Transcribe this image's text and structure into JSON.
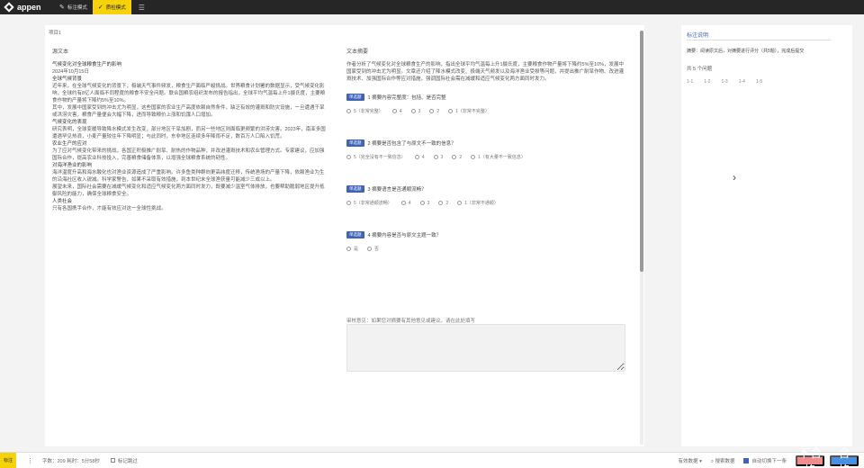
{
  "app": {
    "logo_text": "appen"
  },
  "topbar": {
    "tabs": [
      {
        "label": "标注模式",
        "icon": "edit-icon"
      },
      {
        "label": "质检模式",
        "icon": "check-icon"
      }
    ],
    "extra_icon": "list-icon"
  },
  "card": {
    "header": "项目1",
    "left_title": "源文本",
    "right_title": "文本摘要"
  },
  "source_text": [
    "气候变化对全球粮食生产的影响",
    "2024年10月15日",
    "全球气候背景",
    "近年来，在全球气候变化的背景下，极端天气事件频发，粮食生产面临严峻挑战。世界粮食计划署的数据显示，受气候变化影响，全球约有8亿人面临不同程度的粮食不安全问题。联合国粮农组织发布的报告指出，全球平均气温每上升1摄氏度，主要粮食作物的产量将下降约5%至10%。",
    "其中，发展中国家受到的冲击尤为明显，这些国家的农业生产高度依赖自然条件，缺乏有效的灌溉和防灾设施，一旦遭遇干旱或洪涝灾害，粮食产量便会大幅下降，进而导致粮价上涨和饥饿人口增加。",
    "气候变化的表现",
    "研究表明，全球变暖导致降水模式发生改变，部分地区干旱加剧，而另一些地区则面临更频繁的洪涝灾害。2023年，南亚多国遭遇罕见热浪，小麦产量较往年下降明显；与此同时，东非地区连续多年降雨不足，数百万人口陷入饥荒。",
    "农业生产的应对",
    "为了应对气候变化带来的挑战，各国正积极推广耐旱、耐热的作物品种，并改进灌溉技术和农业管理方式。专家建议，应加强国际合作，提高农业科技投入，完善粮食储备体系，以增强全球粮食系统的韧性。",
    "对海洋渔业的影响",
    "海洋温度升高和海水酸化也对渔业资源造成了严重影响。许多鱼类种群向更高纬度迁移，传统渔场的产量下降，依赖渔业为生的沿海社区收入锐减。科学家警告，如果不采取有效措施，到本世纪末全球渔获量可能减少三成以上。",
    "展望未来，国际社会需要在减缓气候变化和适应气候变化两方面同时发力，既要减少温室气体排放，也要帮助脆弱地区提升抵御风险的能力，确保全球粮食安全。",
    "人类社会",
    "只有各国携手合作，才能有效应对这一全球性挑战。"
  ],
  "summary": {
    "text": "作者分析了气候变化对全球粮食生产的影响，指出全球平均气温每上升1摄氏度，主要粮食作物产量将下降约5%至10%，发展中国家受到的冲击尤为明显。文章还介绍了降水模式改变、极端天气频发以及海洋渔业受损等问题，并提出推广耐旱作物、改进灌溉技术、加强国际合作等应对措施，强调国际社会需在减缓和适应气候变化两方面同时发力。"
  },
  "questions": [
    {
      "badge": "单选题",
      "title": "1 摘要内容完整度：包括、是否完整",
      "options": [
        "5（非常完整）",
        "4",
        "3",
        "2",
        "1（非常不完整）"
      ]
    },
    {
      "badge": "单选题",
      "title": "2 摘要是否包含了与原文不一致的信息？",
      "options": [
        "5（完全没有不一致信息）",
        "4",
        "3",
        "2",
        "1（有大量不一致信息）"
      ]
    },
    {
      "badge": "单选题",
      "title": "3 摘要语言是否通顺流畅？",
      "options": [
        "5（非常通顺流畅）",
        "4",
        "3",
        "2",
        "1（非常不通顺）"
      ]
    },
    {
      "badge": "单选题",
      "title": "4 摘要内容是否与原文主题一致？",
      "options": [
        "是",
        "否"
      ]
    }
  ],
  "comment": {
    "label": "审核意见：如果您对摘要有其他意见或建议，请在此处填写"
  },
  "side_panel": {
    "title": "标注说明",
    "question": "摘要：阅读原文后，对摘要进行评分（共5题），完成后提交",
    "count": "共 5 个问题",
    "numbers": [
      "1-1",
      "1-2",
      "1-3",
      "1-4",
      "1-5"
    ]
  },
  "bottombar": {
    "mini_label": "标注",
    "stats": "字数：209  耗时：5分58秒",
    "mark_label": "标记跳过",
    "select_label": "有效数据",
    "search_label": "搜索数据",
    "auto_next": "自动切换下一条",
    "fail_label": "不合格",
    "pass_label": "合 格"
  }
}
